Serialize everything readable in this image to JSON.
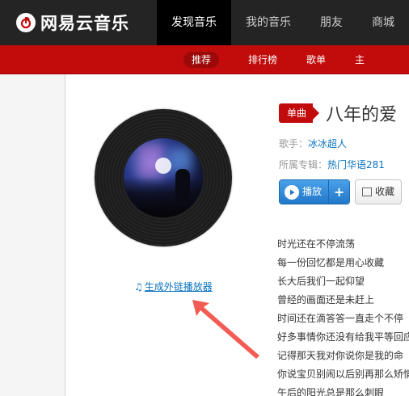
{
  "brand": {
    "name": "网易云音乐",
    "accent": "#c20c0c"
  },
  "nav": {
    "items": [
      {
        "label": "发现音乐",
        "active": true
      },
      {
        "label": "我的音乐",
        "active": false
      },
      {
        "label": "朋友",
        "active": false
      },
      {
        "label": "商城",
        "active": false
      }
    ]
  },
  "subnav": {
    "items": [
      {
        "label": "推荐",
        "selected": true
      },
      {
        "label": "排行榜",
        "selected": false
      },
      {
        "label": "歌单",
        "selected": false
      },
      {
        "label": "主",
        "selected": false
      }
    ]
  },
  "song": {
    "badge": "单曲",
    "title": "八年的爱",
    "singer_label": "歌手：",
    "singer": "冰冰超人",
    "album_label": "所属专辑：",
    "album": "热门华语281",
    "play_label": "播放",
    "add_label": "+",
    "fav_label": "收藏"
  },
  "player": {
    "ext_link": "生成外链播放器"
  },
  "lyrics": [
    "时光还在不停流荡",
    "每一份回忆都是用心收藏",
    "长大后我们一起仰望",
    "曾经的画面还是未赶上",
    "时间还在滴答答一直走个不停",
    "好多事情你还没有给我平等回应",
    "记得那天我对你说你是我的命",
    "你说宝贝别闹以后别再那么矫情",
    "午后的阳光总是那么刺眼"
  ]
}
